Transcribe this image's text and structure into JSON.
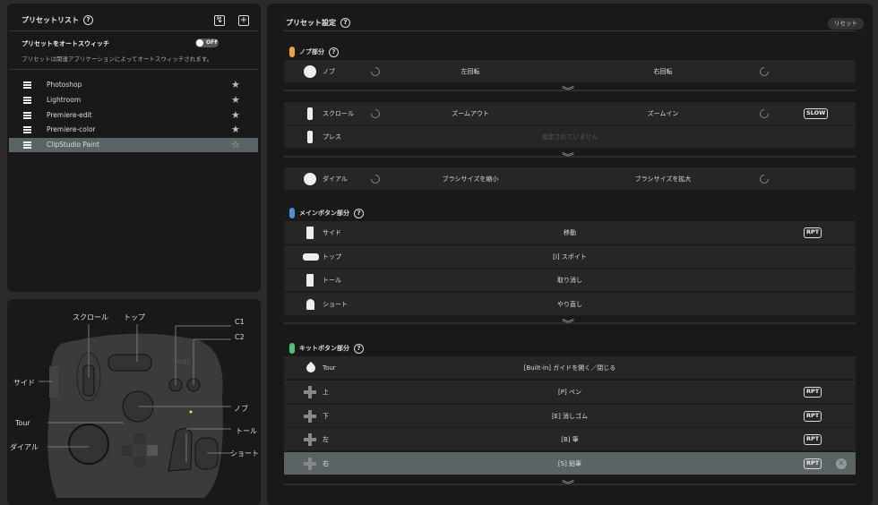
{
  "preset_list": {
    "title": "プリセットリスト",
    "help": "?",
    "import_icon": "import-icon",
    "add_icon": "plus-icon",
    "auto_switch_label": "プリセットをオートスウィッチ",
    "auto_switch_state": "OFF",
    "auto_switch_desc": "プリセットは関連アプリケーションによってオートスウィッチされます。",
    "items": [
      {
        "name": "Photoshop",
        "star": "★"
      },
      {
        "name": "Lightroom",
        "star": "★"
      },
      {
        "name": "Premiere-edit",
        "star": "★"
      },
      {
        "name": "Premiere-color",
        "star": "★"
      },
      {
        "name": "ClipStudio Paint",
        "star": "☆",
        "selected": true
      }
    ]
  },
  "device": {
    "labels": {
      "scroll": "スクロール",
      "top": "トップ",
      "c1": "C1",
      "c2": "C2",
      "side": "サイド",
      "knob": "ノブ",
      "tour": "Tour",
      "tall": "トール",
      "dial": "ダイアル",
      "short": "ショート"
    },
    "logo": "tourbox"
  },
  "settings": {
    "title": "プリセット設定",
    "help": "?",
    "reset": "リセット",
    "knob_section": {
      "title": "ノブ部分",
      "color": "#f0a040"
    },
    "knob": {
      "label": "ノブ",
      "left": "左回転",
      "right": "右回転"
    },
    "scroll": {
      "label": "スクロール",
      "left": "ズームアウト",
      "right": "ズームイン",
      "badge": "SLOW"
    },
    "press": {
      "label": "プレス",
      "value": "設定されていません"
    },
    "dial": {
      "label": "ダイアル",
      "left": "ブラシサイズを縮小",
      "right": "ブラシサイズを拡大"
    },
    "main_section": {
      "title": "メインボタン部分",
      "color": "#4a90d9",
      "rows": [
        {
          "label": "サイド",
          "value": "移動",
          "badge": "RPT"
        },
        {
          "label": "トップ",
          "value": "[I] スポイト"
        },
        {
          "label": "トール",
          "value": "取り消し"
        },
        {
          "label": "ショート",
          "value": "やり直し"
        }
      ]
    },
    "kit_section": {
      "title": "キットボタン部分",
      "color": "#4cc47a",
      "rows": [
        {
          "label": "Tour",
          "value": "[Built-in] ガイドを開く／閉じる"
        },
        {
          "label": "上",
          "value": "[P] ペン",
          "badge": "RPT"
        },
        {
          "label": "下",
          "value": "[E] 消しゴム",
          "badge": "RPT"
        },
        {
          "label": "左",
          "value": "[B] 筆",
          "badge": "RPT"
        },
        {
          "label": "右",
          "value": "[S] 鉛筆",
          "badge": "RPT",
          "selected": true
        }
      ]
    }
  }
}
